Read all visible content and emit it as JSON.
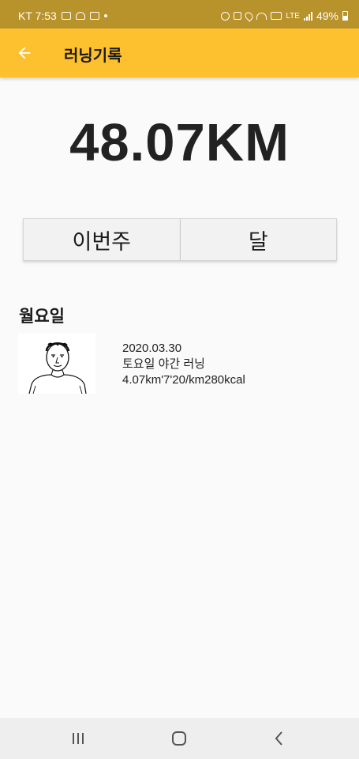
{
  "status_bar": {
    "carrier_time": "KT 7:53",
    "network": "LTE",
    "battery": "49%",
    "left_icons": [
      "image-icon",
      "weather-icon",
      "message-icon",
      "dot-icon"
    ],
    "right_icons": [
      "alarm-icon",
      "mute-icon",
      "location-icon",
      "wifi-icon",
      "hd-icon",
      "lte-icon",
      "signal-icon",
      "battery-icon"
    ]
  },
  "app_bar": {
    "title": "러닝기록",
    "back_icon": "arrow-left-icon",
    "color": "#fdc02e"
  },
  "summary": {
    "total_distance": "48.07KM"
  },
  "tabs": [
    {
      "label": "이번주"
    },
    {
      "label": "달"
    }
  ],
  "sections": [
    {
      "header": "월요일",
      "records": [
        {
          "date": "2020.03.30",
          "title": "토요일 야간 러닝",
          "stats": "4.07km'7'20/km280kcal"
        }
      ]
    }
  ],
  "nav_bar": {
    "icons": [
      "recent-apps-icon",
      "home-icon",
      "back-icon"
    ]
  }
}
